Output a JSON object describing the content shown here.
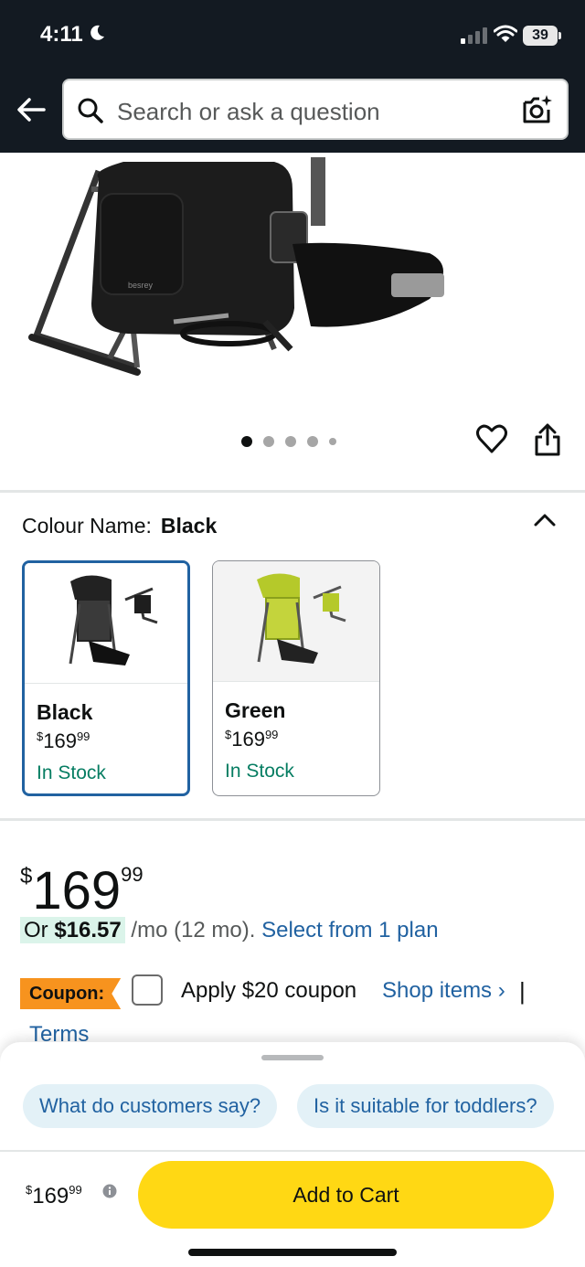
{
  "status_bar": {
    "time": "4:11",
    "battery": "39"
  },
  "header": {
    "search_placeholder": "Search or ask a question"
  },
  "gallery": {
    "dot_count": 5,
    "active_index": 0
  },
  "colour": {
    "label": "Colour Name:",
    "selected": "Black",
    "options": [
      {
        "name": "Black",
        "currency": "$",
        "price": "169",
        "cents": "99",
        "stock": "In Stock",
        "selected": true
      },
      {
        "name": "Green",
        "currency": "$",
        "price": "169",
        "cents": "99",
        "stock": "In Stock",
        "selected": false
      }
    ]
  },
  "price": {
    "currency": "$",
    "whole": "169",
    "cents": "99"
  },
  "monthly": {
    "prefix": "Or ",
    "amount": "$16.57",
    "rest": " /mo (12 mo). ",
    "link": "Select from 1 plan"
  },
  "coupon": {
    "badge": "Coupon:",
    "text": "Apply $20 coupon",
    "shop_link": "Shop items ›",
    "separator": "|",
    "terms": "Terms"
  },
  "sheet": {
    "chips": [
      "What do customers say?",
      "Is it suitable for toddlers?"
    ],
    "footer_currency": "$",
    "footer_whole": "169",
    "footer_cents": "99",
    "cart_label": "Add to Cart"
  },
  "colors": {
    "header_bg": "#131a22",
    "link": "#2162a1",
    "stock_green": "#067d62",
    "cart_yellow": "#ffd814",
    "coupon_orange": "#f7931e"
  }
}
